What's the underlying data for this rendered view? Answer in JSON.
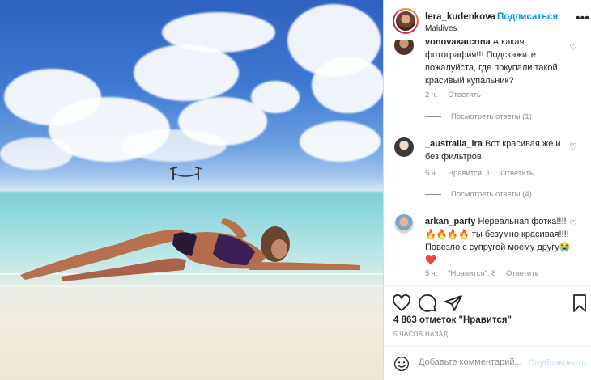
{
  "header": {
    "username": "lera_kudenkova",
    "dot": "•",
    "follow_label": "Подписаться",
    "location": "Maldives",
    "more_icon": "more-horizontal-icon"
  },
  "comments": [
    {
      "user": "vohovakatcriha",
      "text": "А какая фотография!!! Подскажите пожалуйста, где покупали такой красивый купальник?",
      "time": "2 ч.",
      "likes": "",
      "reply_label": "Ответить",
      "view_replies": "Посмотреть ответы (1)"
    },
    {
      "user": "_australia_ira",
      "text": "Вот красивая же и без фильтров.",
      "time": "5 ч.",
      "likes": "Нравится: 1",
      "reply_label": "Ответить",
      "view_replies": "Посмотреть ответы (4)"
    },
    {
      "user": "arkan_party",
      "text": "Нереальная фотка!!!!🔥🔥🔥🔥 ты безумно красивая!!!! Повезло с супругой моему другу😭❤️",
      "time": "5 ч.",
      "likes": "\"Нравится\": 8",
      "reply_label": "Ответить"
    }
  ],
  "actions": {
    "like_icon": "heart-icon",
    "comment_icon": "comment-icon",
    "share_icon": "share-icon",
    "save_icon": "bookmark-icon"
  },
  "likes_text": "4 863 отметок \"Нравится\"",
  "time_ago": "5 ЧАСОВ НАЗАД",
  "add_comment": {
    "placeholder": "Добавьте комментарий...",
    "publish_label": "Опубликовать"
  },
  "colors": {
    "accent": "#0095f6",
    "muted": "#8e8e8e",
    "text": "#262626"
  }
}
